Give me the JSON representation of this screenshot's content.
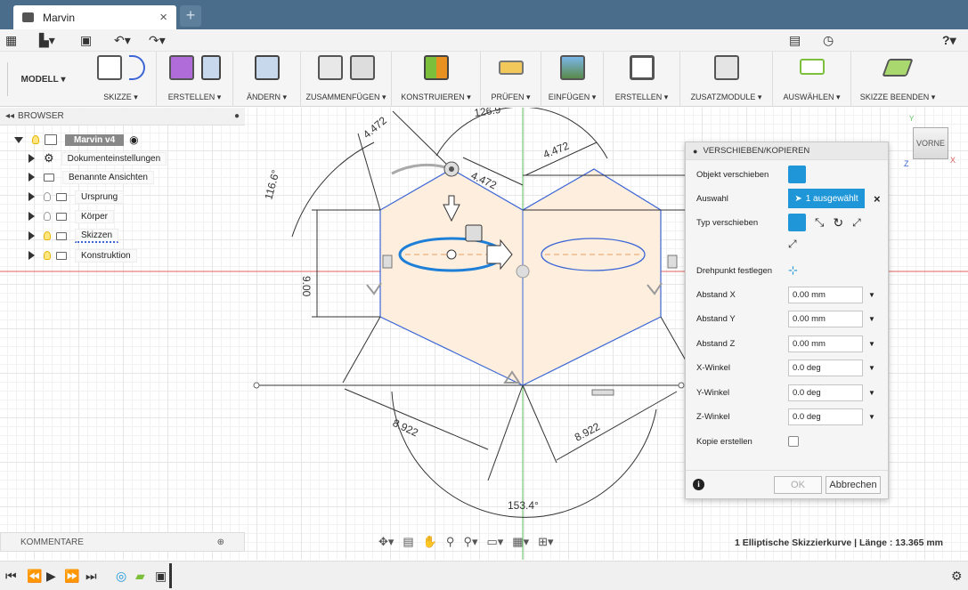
{
  "window": {
    "tab_title": "Marvin",
    "close_symbol": "×",
    "new_tab_symbol": "+"
  },
  "quick_access": {
    "grid_icon": "apps-grid-icon",
    "file_icon": "file-menu-icon",
    "save_icon": "save-icon",
    "undo_icon": "undo-icon",
    "redo_icon": "redo-icon",
    "jobs_icon": "job-status-icon",
    "clock_icon": "clock-icon",
    "help_icon": "help-icon",
    "help_glyph": "?"
  },
  "ribbon": {
    "workspace": "MODELL",
    "groups": [
      {
        "label": "SKIZZE",
        "icon": "sketch-icon"
      },
      {
        "label": "ERSTELLEN",
        "icon": "create-icon"
      },
      {
        "label": "ÄNDERN",
        "icon": "modify-icon"
      },
      {
        "label": "ZUSAMMENFÜGEN",
        "icon": "assemble-icon"
      },
      {
        "label": "KONSTRUIEREN",
        "icon": "construct-icon"
      },
      {
        "label": "PRÜFEN",
        "icon": "inspect-icon"
      },
      {
        "label": "EINFÜGEN",
        "icon": "insert-icon"
      },
      {
        "label": "ERSTELLEN",
        "icon": "make-icon"
      },
      {
        "label": "ZUSATZMODULE",
        "icon": "addins-icon"
      },
      {
        "label": "AUSWÄHLEN",
        "icon": "select-icon"
      },
      {
        "label": "SKIZZE BEENDEN",
        "icon": "stop-sketch-icon"
      }
    ],
    "colors": {
      "accent": "#1e96d8",
      "sketch": "#3c66d6",
      "fill": "#fdeede"
    }
  },
  "browser": {
    "header": "BROWSER",
    "collapse_symbol": "◂◂",
    "items": [
      {
        "label": "Marvin v4"
      },
      {
        "label": "Dokumenteinstellungen"
      },
      {
        "label": "Benannte Ansichten"
      },
      {
        "label": "Ursprung"
      },
      {
        "label": "Körper"
      },
      {
        "label": "Skizzen"
      },
      {
        "label": "Konstruktion"
      }
    ]
  },
  "comments": {
    "label": "KOMMENTARE"
  },
  "sketch": {
    "dims": {
      "d1": "4.472",
      "d2": "126.9",
      "d3": "4.472",
      "d4": "4.472",
      "d5": "116.6°",
      "d6": "9.00",
      "d7": "8.922",
      "d8": "8.922",
      "d9": "153.4°"
    }
  },
  "panel": {
    "title": "VERSCHIEBEN/KOPIEREN",
    "rows": {
      "object_label": "Objekt verschieben",
      "selection_label": "Auswahl",
      "selection_value": "1 ausgewählt",
      "selection_clear": "×",
      "move_type_label": "Typ verschieben",
      "pivot_label": "Drehpunkt festlegen",
      "dx_label": "Abstand X",
      "dx_value": "0.00 mm",
      "dy_label": "Abstand Y",
      "dy_value": "0.00 mm",
      "dz_label": "Abstand Z",
      "dz_value": "0.00 mm",
      "rx_label": "X-Winkel",
      "rx_value": "0.0 deg",
      "ry_label": "Y-Winkel",
      "ry_value": "0.0 deg",
      "rz_label": "Z-Winkel",
      "rz_value": "0.0 deg",
      "copy_label": "Kopie erstellen"
    },
    "info_symbol": "i",
    "ok": "OK",
    "cancel": "Abbrechen"
  },
  "viewcube": {
    "face": "VORNE",
    "y_axis": "Y",
    "x_axis": "X",
    "z_axis": "Z"
  },
  "status": {
    "text": "1 Elliptische Skizzierkurve | Länge : 13.365 mm"
  },
  "navbar": {
    "icons": [
      "orbit-icon",
      "look-at-icon",
      "pan-icon",
      "zoom-icon",
      "zoom-window-icon",
      "display-icon",
      "grid-icon",
      "viewports-icon"
    ]
  }
}
